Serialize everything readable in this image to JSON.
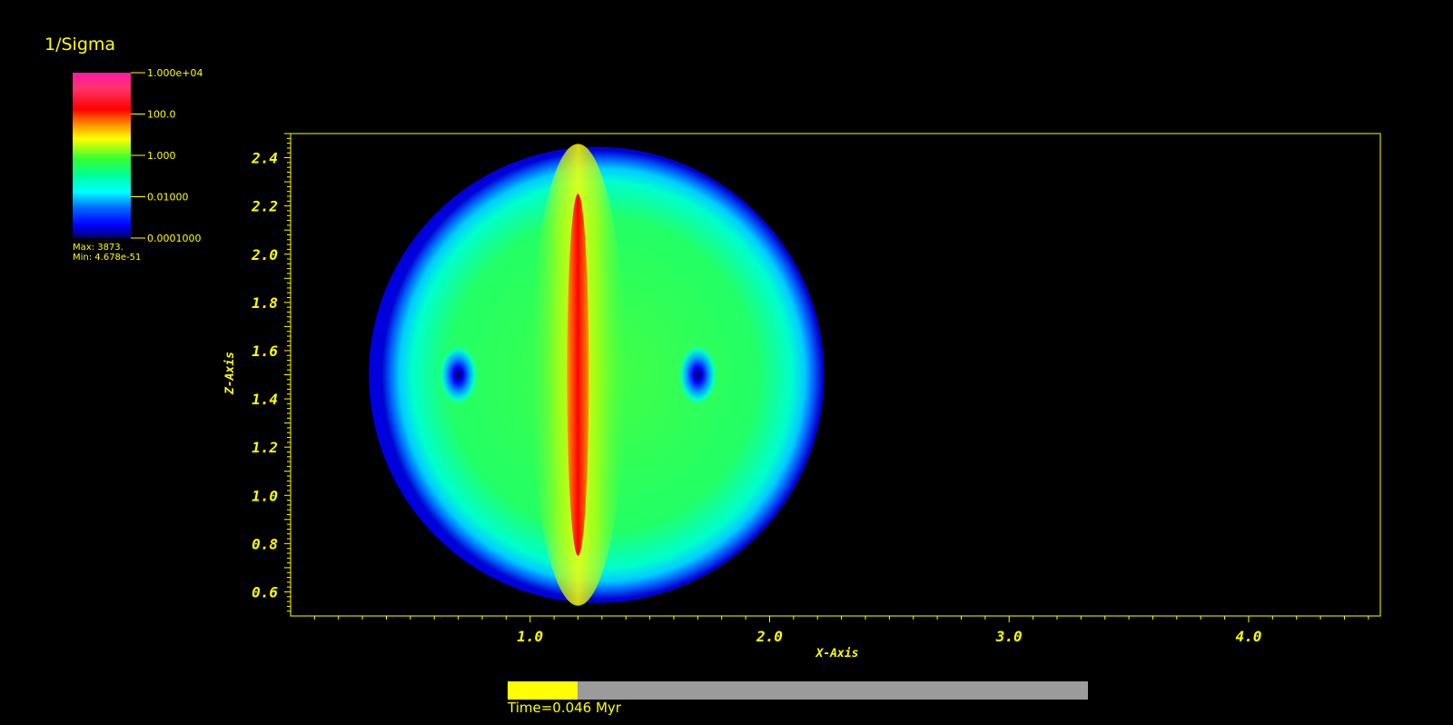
{
  "legend": {
    "title": "1/Sigma",
    "ticks": [
      "1.000e+04",
      "100.0",
      "1.000",
      "0.01000",
      "0.0001000"
    ],
    "max_label": "Max:  3873.",
    "min_label": "Min:  4.678e-51"
  },
  "chart_data": {
    "type": "heatmap",
    "title": "",
    "xlabel": "X-Axis",
    "ylabel": "Z-Axis",
    "xlim": [
      0.0,
      4.55
    ],
    "ylim": [
      0.5,
      2.5
    ],
    "x_ticks": [
      1.0,
      2.0,
      3.0,
      4.0
    ],
    "x_tick_labels": [
      "1.0",
      "2.0",
      "3.0",
      "4.0"
    ],
    "y_ticks": [
      0.6,
      0.8,
      1.0,
      1.2,
      1.4,
      1.6,
      1.8,
      2.0,
      2.2,
      2.4
    ],
    "y_tick_labels": [
      "0.6",
      "0.8",
      "1.0",
      "1.2",
      "1.4",
      "1.6",
      "1.8",
      "2.0",
      "2.2",
      "2.4"
    ],
    "colorbar": {
      "scale": "log",
      "min": 0.0001,
      "max": 10000
    },
    "field": {
      "shape": "disk",
      "center_x": 1.3,
      "center_z": 1.5,
      "radius_x": 0.92,
      "radius_z": 0.93,
      "jet_x": 1.2,
      "jet_z_range": [
        0.75,
        2.25
      ],
      "voids": [
        {
          "x": 0.7,
          "z": 1.5
        },
        {
          "x": 1.7,
          "z": 1.5
        }
      ]
    },
    "grid": false
  },
  "time": {
    "label": "Time=0.046 Myr",
    "progress": 0.12
  },
  "colors": {
    "axis": "#ffff00",
    "background": "#000000",
    "progress_track": "#9b9b9b",
    "progress_fill": "#ffff00"
  }
}
